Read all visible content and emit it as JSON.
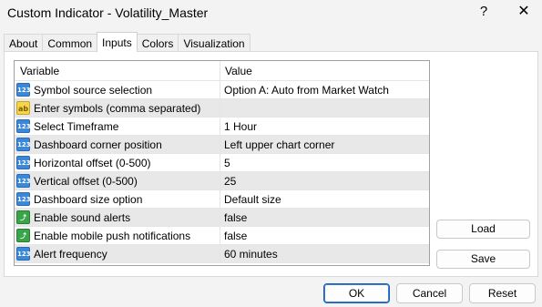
{
  "window": {
    "title": "Custom Indicator - Volatility_Master",
    "help_glyph": "?",
    "close_glyph": "✕"
  },
  "tabs": [
    {
      "label": "About"
    },
    {
      "label": "Common"
    },
    {
      "label": "Inputs"
    },
    {
      "label": "Colors"
    },
    {
      "label": "Visualization"
    }
  ],
  "active_tab": "Inputs",
  "grid": {
    "columns": {
      "variable": "Variable",
      "value": "Value"
    },
    "rows": [
      {
        "icon": "numeric-icon",
        "glyph": "123",
        "label": "Symbol source selection",
        "value": "Option A: Auto from Market Watch"
      },
      {
        "icon": "string-icon",
        "glyph": "ab",
        "label": "Enter symbols (comma separated)",
        "value": ""
      },
      {
        "icon": "numeric-icon",
        "glyph": "123",
        "label": "Select Timeframe",
        "value": "1 Hour"
      },
      {
        "icon": "numeric-icon",
        "glyph": "123",
        "label": "Dashboard corner position",
        "value": "Left upper chart corner"
      },
      {
        "icon": "numeric-icon",
        "glyph": "123",
        "label": "Horizontal offset (0-500)",
        "value": "5"
      },
      {
        "icon": "numeric-icon",
        "glyph": "123",
        "label": "Vertical offset (0-500)",
        "value": "25"
      },
      {
        "icon": "numeric-icon",
        "glyph": "123",
        "label": "Dashboard size option",
        "value": "Default size"
      },
      {
        "icon": "boolean-icon",
        "glyph": "⤴",
        "label": "Enable sound alerts",
        "value": "false"
      },
      {
        "icon": "boolean-icon",
        "glyph": "⤴",
        "label": "Enable mobile push notifications",
        "value": "false"
      },
      {
        "icon": "numeric-icon",
        "glyph": "123",
        "label": "Alert frequency",
        "value": "60 minutes"
      }
    ]
  },
  "side_buttons": {
    "load": "Load",
    "save": "Save"
  },
  "footer": {
    "ok": "OK",
    "cancel": "Cancel",
    "reset": "Reset"
  },
  "colors": {
    "numeric_icon": "#3b87d8",
    "string_icon": "#f4d54b",
    "boolean_icon": "#3aa548",
    "alt_row": "#e8e8e8",
    "primary_border": "#1a5fb4"
  }
}
